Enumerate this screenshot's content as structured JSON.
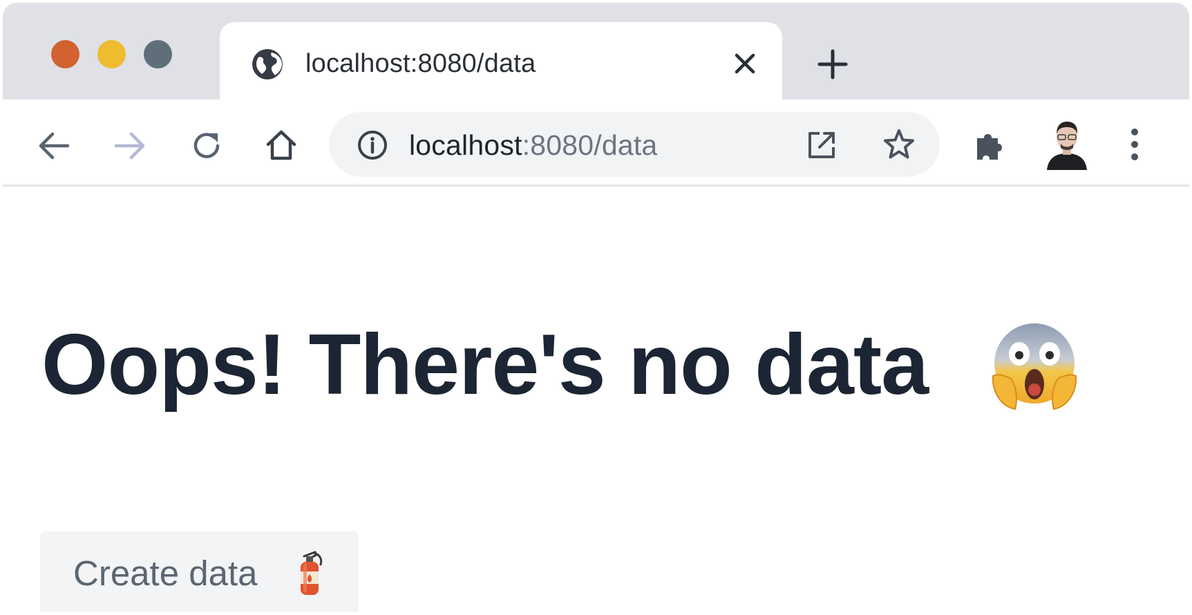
{
  "window": {
    "controls": [
      "close",
      "minimize",
      "maximize"
    ],
    "control_colors": {
      "close": "#d2622f",
      "minimize": "#efbb2f",
      "maximize": "#5e6f79"
    }
  },
  "tab": {
    "title": "localhost:8080/data",
    "icon": "globe-icon",
    "close_icon": "close-icon"
  },
  "new_tab_icon": "plus-icon",
  "toolbar": {
    "back_icon": "arrow-left-icon",
    "forward_icon": "arrow-right-icon",
    "reload_icon": "reload-icon",
    "home_icon": "home-icon",
    "address": {
      "host": "localhost",
      "rest": ":8080/data",
      "info_icon": "info-icon",
      "open_icon": "external-link-icon",
      "bookmark_icon": "star-icon"
    },
    "extensions_icon": "puzzle-icon",
    "menu_icon": "kebab-menu-icon"
  },
  "page": {
    "heading": "Oops! There's no data",
    "heading_emoji": "screaming-face-emoji",
    "button_label": "Create data",
    "button_icon": "fire-extinguisher-emoji"
  },
  "colors": {
    "accent_text": "#1c2533",
    "button_bg": "#f3f4f6",
    "tabstrip_bg": "#dfe1e6"
  }
}
